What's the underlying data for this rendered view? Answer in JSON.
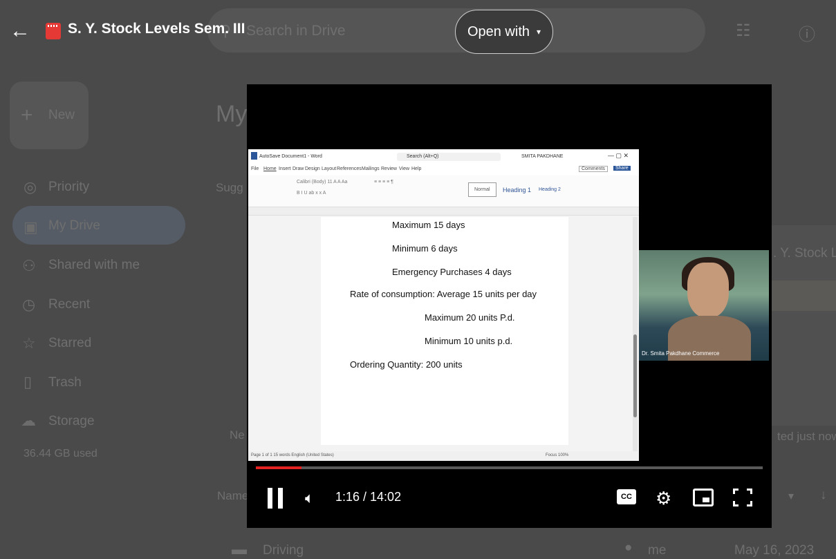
{
  "header": {
    "back_icon": "arrow-left-icon",
    "file_icon": "video-file-icon",
    "file_title": "S. Y. Stock Levels Sem. III",
    "open_with_label": "Open with",
    "open_with_caret": "▾"
  },
  "drive_background": {
    "search_placeholder": "Search in Drive",
    "new_label": "New",
    "page_heading": "My",
    "suggested_label": "Sugg",
    "sidebar": [
      {
        "label": "Priority",
        "icon": "check-circle-icon"
      },
      {
        "label": "My Drive",
        "icon": "drive-icon"
      },
      {
        "label": "Shared with me",
        "icon": "people-icon"
      },
      {
        "label": "Recent",
        "icon": "clock-icon"
      },
      {
        "label": "Starred",
        "icon": "star-icon"
      },
      {
        "label": "Trash",
        "icon": "trash-icon"
      },
      {
        "label": "Storage",
        "icon": "cloud-icon"
      }
    ],
    "storage_used": "36.44 GB used",
    "card_title_fragment": ". Y. Stock Le",
    "card_edited_fragment": "ted just now",
    "new_fragment": "Ne",
    "name_header_fragment": "Name",
    "row_name": "Driving",
    "row_owner": "me",
    "row_date": "May 16, 2023"
  },
  "video": {
    "word": {
      "title_bar": "AutoSave  Document1 - Word",
      "search": "Search (Alt+Q)",
      "user": "SMITA PAKDHANE",
      "menu": [
        "File",
        "Home",
        "Insert",
        "Draw",
        "Design",
        "Layout",
        "References",
        "Mailings",
        "Review",
        "View",
        "Help"
      ],
      "comments": "Comments",
      "share": "Share",
      "styles": [
        "Normal",
        "Heading 1",
        "Heading 2"
      ],
      "status_left": "Page 1 of 1   15 words   English (United States)",
      "status_right": "Focus   100%",
      "lines": [
        "Maximum 15 days",
        "Minimum  6 days",
        "Emergency Purchases 4 days",
        "Rate of consumption:   Average 15 units per day",
        "Maximum 20 units P.d.",
        "Minimum 10 units p.d.",
        "Ordering Quantity:  200 units"
      ]
    },
    "camera_label": "Dr. Smita Pakdhane Commerce",
    "time": "1:16 / 14:02",
    "progress": 0.0902,
    "progress_color": "#e52222",
    "cc_label": "CC",
    "icons": {
      "pause": "pause-icon",
      "volume": "volume-icon",
      "settings": "gear-icon",
      "miniplayer": "miniplayer-icon",
      "fullscreen": "fullscreen-icon"
    }
  }
}
